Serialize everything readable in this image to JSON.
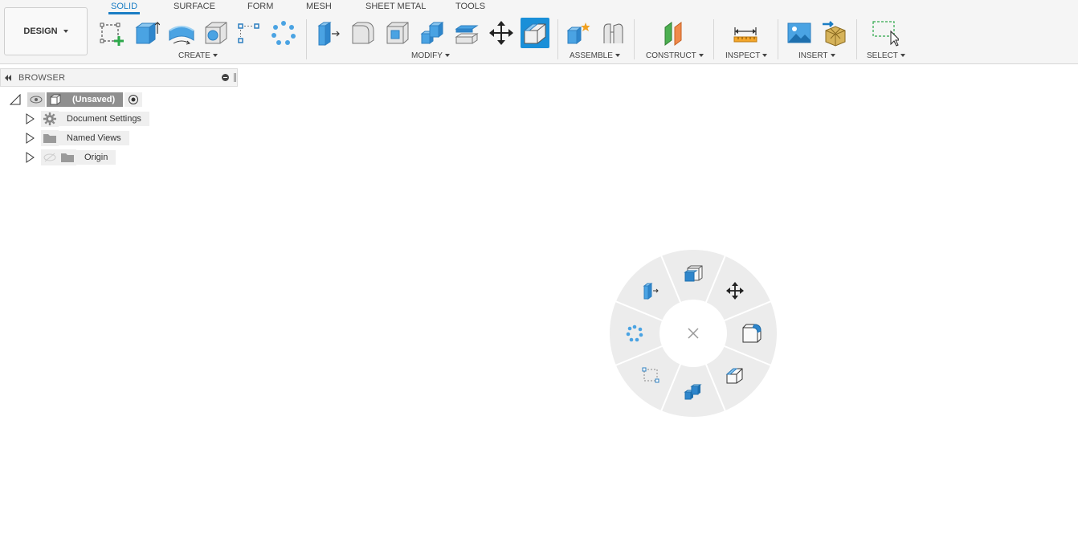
{
  "toolbar": {
    "workspace_label": "DESIGN",
    "tabs": [
      {
        "label": "SOLID"
      },
      {
        "label": "SURFACE"
      },
      {
        "label": "FORM"
      },
      {
        "label": "MESH"
      },
      {
        "label": "SHEET METAL"
      },
      {
        "label": "TOOLS"
      }
    ],
    "groups": {
      "create": "CREATE",
      "modify": "MODIFY",
      "assemble": "ASSEMBLE",
      "construct": "CONSTRUCT",
      "inspect": "INSPECT",
      "insert": "INSERT",
      "select": "SELECT"
    },
    "active_tab": "SOLID",
    "accent_color": "#1a7dc4"
  },
  "browser": {
    "title": "BROWSER",
    "root": {
      "label": "(Unsaved)"
    },
    "items": [
      {
        "label": "Document Settings",
        "icon": "gear-icon"
      },
      {
        "label": "Named Views",
        "icon": "folder-icon"
      },
      {
        "label": "Origin",
        "icon": "folder-icon"
      }
    ]
  },
  "marking_menu": {
    "center_icon": "close-icon",
    "items": [
      "new-component-icon",
      "move-icon",
      "fillet-icon",
      "chamfer-icon",
      "combine-icon",
      "sketch-icon",
      "pattern-icon",
      "press-pull-icon"
    ]
  }
}
